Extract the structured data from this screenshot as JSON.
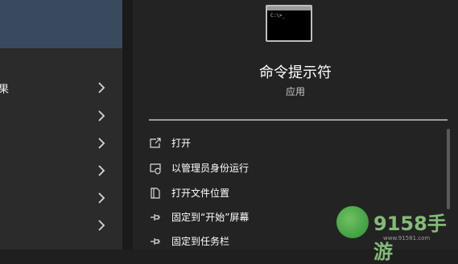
{
  "left_panel": {
    "rows": [
      {
        "label": "果",
        "chevron": "chevron-right-icon"
      },
      {
        "label": "",
        "chevron": "chevron-right-icon"
      },
      {
        "label": "",
        "chevron": "chevron-right-icon"
      },
      {
        "label": "",
        "chevron": "chevron-right-icon"
      },
      {
        "label": "",
        "chevron": "chevron-right-icon"
      },
      {
        "label": "",
        "chevron": "chevron-right-icon"
      }
    ]
  },
  "app": {
    "icon": "command-prompt-icon",
    "prompt_text": "C:\\>_",
    "title": "命令提示符",
    "subtitle": "应用"
  },
  "actions": [
    {
      "icon": "open-icon",
      "label": "打开"
    },
    {
      "icon": "run-as-admin-icon",
      "label": "以管理员身份运行"
    },
    {
      "icon": "folder-location-icon",
      "label": "打开文件位置"
    },
    {
      "icon": "pin-icon",
      "label": "固定到“开始”屏幕"
    },
    {
      "icon": "pin-icon",
      "label": "固定到任务栏"
    }
  ],
  "watermark": {
    "text": "9158手游",
    "url": "www.91581.com"
  },
  "colors": {
    "left_bg": "#2b2b2b",
    "right_bg": "#232323",
    "selection": "#3a4a5e"
  }
}
